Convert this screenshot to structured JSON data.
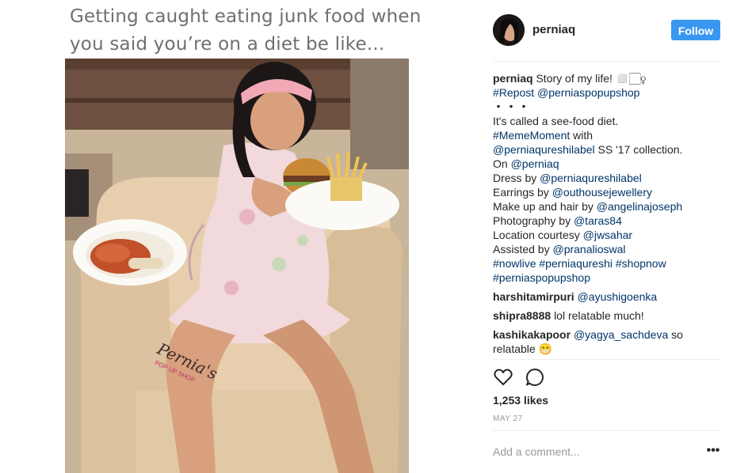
{
  "media": {
    "meme_caption": "Getting caught eating junk food when you said you’re on a diet be like...",
    "watermark": "Pernia's POP-UP SHOP"
  },
  "header": {
    "username": "perniaq",
    "follow_label": "Follow"
  },
  "post_caption": {
    "username": "perniaq",
    "text": "Story of my life! ◻️🏻‍♀",
    "lines": [
      {
        "segments": [
          {
            "t": "#Repost @perniaspopupshop",
            "tag": true
          }
        ]
      },
      {
        "segments": [
          {
            "t": "・・・",
            "tag": false,
            "dots": true
          }
        ]
      },
      {
        "segments": [
          {
            "t": "It's called a see-food diet.",
            "tag": false
          }
        ]
      },
      {
        "segments": [
          {
            "t": "#MemeMoment",
            "tag": true
          },
          {
            "t": " with",
            "tag": false
          }
        ]
      },
      {
        "segments": [
          {
            "t": "@perniaqureshilabel",
            "tag": true
          },
          {
            "t": " SS '17 collection.",
            "tag": false
          }
        ]
      },
      {
        "segments": [
          {
            "t": "On ",
            "tag": false
          },
          {
            "t": "@perniaq",
            "tag": true
          }
        ]
      },
      {
        "segments": [
          {
            "t": "Dress by ",
            "tag": false
          },
          {
            "t": "@perniaqureshilabel",
            "tag": true
          }
        ]
      },
      {
        "segments": [
          {
            "t": "Earrings by ",
            "tag": false
          },
          {
            "t": "@outhousejewellery",
            "tag": true
          }
        ]
      },
      {
        "segments": [
          {
            "t": "Make up and hair by ",
            "tag": false
          },
          {
            "t": "@angelinajoseph",
            "tag": true
          }
        ]
      },
      {
        "segments": [
          {
            "t": "Photography by ",
            "tag": false
          },
          {
            "t": "@taras84",
            "tag": true
          }
        ]
      },
      {
        "segments": [
          {
            "t": "Location courtesy ",
            "tag": false
          },
          {
            "t": "@jwsahar",
            "tag": true
          }
        ]
      },
      {
        "segments": [
          {
            "t": "Assisted by ",
            "tag": false
          },
          {
            "t": "@pranalioswal",
            "tag": true
          }
        ]
      },
      {
        "segments": [
          {
            "t": "#nowlive #perniaqureshi #shopnow",
            "tag": true
          }
        ]
      },
      {
        "segments": [
          {
            "t": "#perniaspopupshop",
            "tag": true
          }
        ]
      }
    ]
  },
  "comments": [
    {
      "user": "harshitamirpuri",
      "text": "@ayushigoenka",
      "tag": true
    },
    {
      "user": "shipra8888",
      "text": "lol relatable much!",
      "tag": false
    },
    {
      "user": "kashikakapoor",
      "text": "@yagya_sachdeva",
      "tag": true,
      "rest": " so",
      "line2": "relatable 😁"
    }
  ],
  "likes": "1,253 likes",
  "date": "MAY 27",
  "add_comment_placeholder": "Add a comment...",
  "more_label": "•••",
  "icons": {
    "like": "heart-icon",
    "comment": "comment-bubble-icon",
    "more": "more-options-icon"
  },
  "colors": {
    "follow": "#3897f0",
    "hashtag": "#003569",
    "muted": "#999999"
  }
}
